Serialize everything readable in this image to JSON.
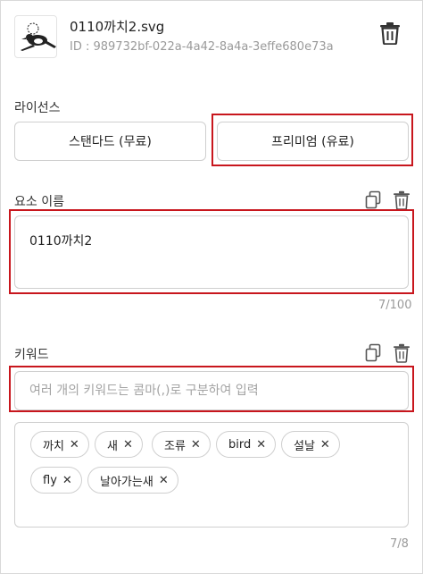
{
  "file": {
    "name": "0110까치2.svg",
    "id_text": "ID : 989732bf-022a-4a42-8a4a-3effe680e73a"
  },
  "license": {
    "label": "라이선스",
    "standard": "스탠다드 (무료)",
    "premium": "프리미엄 (유료)"
  },
  "element_name": {
    "label": "요소 이름",
    "value": "0110까치2",
    "counter": "7/100"
  },
  "keywords": {
    "label": "키워드",
    "placeholder": "여러 개의 키워드는 콤마(,)로 구분하여 입력",
    "tags": [
      "까치",
      "새",
      "조류",
      "bird",
      "설날",
      "fly",
      "날아가는새"
    ],
    "remove_symbol": "✕",
    "counter": "7/8"
  },
  "colors": {
    "highlight": "#c8161d",
    "border": "#cfcfcf",
    "muted_text": "#9a9a9a"
  },
  "icons": [
    "magpie-thumbnail",
    "trash-icon",
    "copy-icon",
    "close-icon"
  ]
}
